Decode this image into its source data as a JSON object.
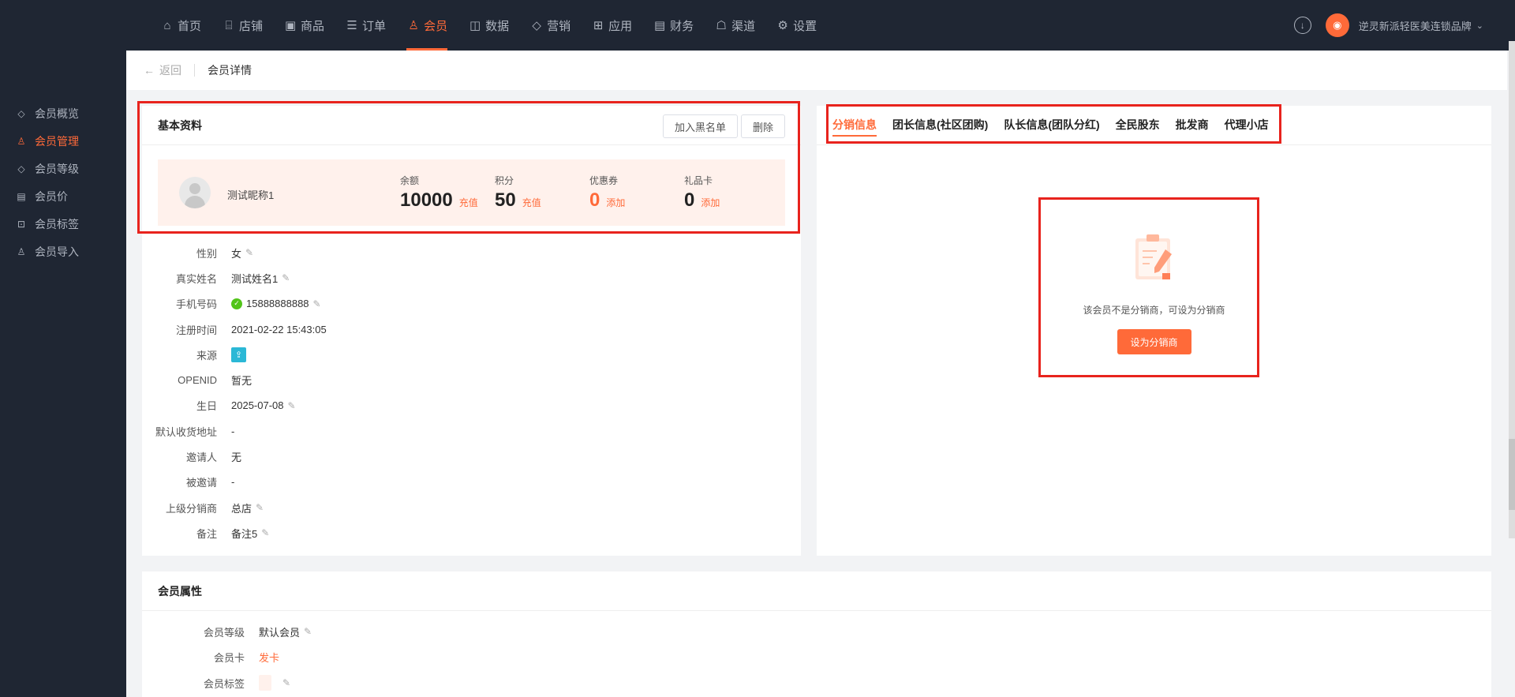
{
  "nav": {
    "items": [
      {
        "label": "首页",
        "icon": "home-icon",
        "glyph": "⌂"
      },
      {
        "label": "店铺",
        "icon": "store-icon",
        "glyph": "⌸"
      },
      {
        "label": "商品",
        "icon": "goods-icon",
        "glyph": "▣"
      },
      {
        "label": "订单",
        "icon": "order-icon",
        "glyph": "☰"
      },
      {
        "label": "会员",
        "icon": "member-icon",
        "glyph": "♙"
      },
      {
        "label": "数据",
        "icon": "data-icon",
        "glyph": "◫"
      },
      {
        "label": "营销",
        "icon": "marketing-icon",
        "glyph": "◇"
      },
      {
        "label": "应用",
        "icon": "app-icon",
        "glyph": "⊞"
      },
      {
        "label": "财务",
        "icon": "finance-icon",
        "glyph": "▤"
      },
      {
        "label": "渠道",
        "icon": "channel-icon",
        "glyph": "☖"
      },
      {
        "label": "设置",
        "icon": "settings-icon",
        "glyph": "⚙"
      }
    ],
    "active": "会员",
    "shop_name": "逆灵新派轻医美连锁品牌"
  },
  "sidebar": {
    "items": [
      {
        "label": "会员概览",
        "icon": "overview-icon"
      },
      {
        "label": "会员管理",
        "icon": "member-manage-icon"
      },
      {
        "label": "会员等级",
        "icon": "level-icon"
      },
      {
        "label": "会员价",
        "icon": "price-icon"
      },
      {
        "label": "会员标签",
        "icon": "tag-icon"
      },
      {
        "label": "会员导入",
        "icon": "import-icon"
      }
    ],
    "active": "会员管理"
  },
  "crumb": {
    "back": "返回",
    "title": "会员详情"
  },
  "basic": {
    "title": "基本资料",
    "blacklist_btn": "加入黑名单",
    "delete_btn": "删除",
    "nickname": "测试昵称1",
    "stats": [
      {
        "label": "余额",
        "value": "10000",
        "action": "充值"
      },
      {
        "label": "积分",
        "value": "50",
        "action": "充值"
      },
      {
        "label": "优惠券",
        "value": "0",
        "action": "添加"
      },
      {
        "label": "礼品卡",
        "value": "0",
        "action": "添加"
      }
    ],
    "fields": [
      {
        "k": "性别",
        "v": "女",
        "editable": true
      },
      {
        "k": "真实姓名",
        "v": "测试姓名1",
        "editable": true
      },
      {
        "k": "手机号码",
        "v": "15888888888",
        "editable": true,
        "verified": true
      },
      {
        "k": "注册时间",
        "v": "2021-02-22 15:43:05",
        "editable": false
      },
      {
        "k": "来源",
        "v": "",
        "editable": false,
        "source_icon": true
      },
      {
        "k": "OPENID",
        "v": "暂无",
        "editable": false
      },
      {
        "k": "生日",
        "v": "2025-07-08",
        "editable": true
      },
      {
        "k": "默认收货地址",
        "v": "-",
        "editable": false
      },
      {
        "k": "邀请人",
        "v": "无",
        "editable": false
      },
      {
        "k": "被邀请",
        "v": "-",
        "editable": false
      },
      {
        "k": "上级分销商",
        "v": "总店",
        "editable": true
      },
      {
        "k": "备注",
        "v": "备注5",
        "editable": true
      }
    ]
  },
  "tabs": [
    "分销信息",
    "团长信息(社区团购)",
    "队长信息(团队分红)",
    "全民股东",
    "批发商",
    "代理小店"
  ],
  "active_tab": "分销信息",
  "distribution": {
    "empty_text": "该会员不是分销商，可设为分销商",
    "set_btn": "设为分销商"
  },
  "attributes": {
    "title": "会员属性",
    "level_label": "会员等级",
    "level_value": "默认会员",
    "card_label": "会员卡",
    "card_action": "发卡",
    "tags_label": "会员标签"
  },
  "colors": {
    "accent": "#ff6a39",
    "nav_bg": "#1f2633",
    "highlight": "#e8231d"
  }
}
